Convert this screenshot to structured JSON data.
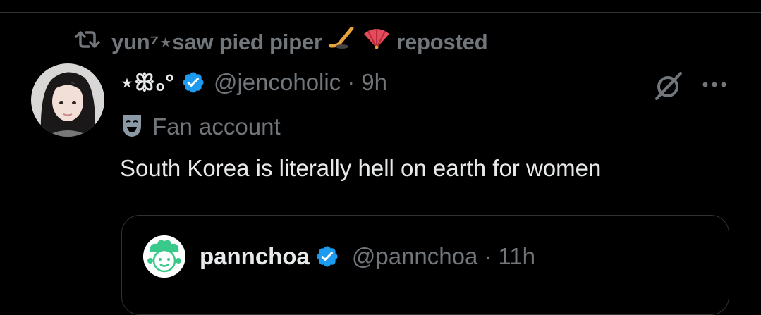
{
  "repost": {
    "user": "yun⁷⋆saw pied piper",
    "suffix": "reposted",
    "emojis": [
      "ice-hockey-emoji",
      "folding-fan-emoji"
    ]
  },
  "tweet": {
    "display_name": "⋆ꕥ₀°",
    "handle": "@jencoholic",
    "separator": "·",
    "time": "9h",
    "label": "Fan account",
    "text": "South Korea is literally hell on earth for women"
  },
  "quote": {
    "display_name": "pannchoa",
    "handle": "@pannchoa",
    "separator": "·",
    "time": "11h"
  },
  "colors": {
    "background": "#000000",
    "text_primary": "#e7e9ea",
    "text_secondary": "#71767b",
    "verified_blue": "#1d9bf0",
    "divider": "#2f3336"
  }
}
